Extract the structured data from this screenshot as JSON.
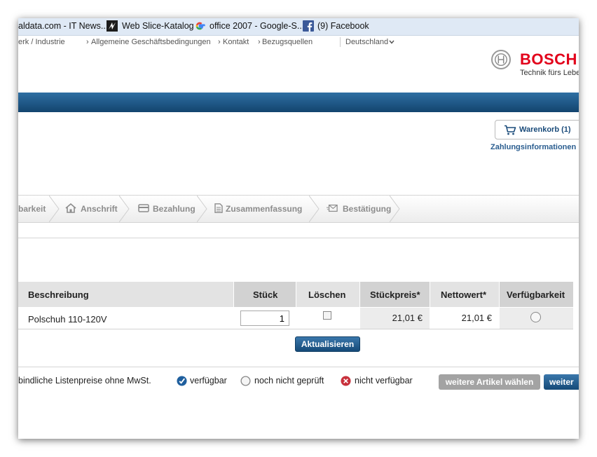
{
  "favorites": [
    {
      "label": "aldata.com - IT News..."
    },
    {
      "label": "Web Slice-Katalog"
    },
    {
      "label": "office 2007 - Google-S..."
    },
    {
      "label": "(9) Facebook"
    }
  ],
  "top_links": {
    "partial": "erk / Industrie",
    "terms": "Allgemeine Geschäftsbedingungen",
    "contact": "Kontakt",
    "sources": "Bezugsquellen",
    "country": "Deutschland"
  },
  "brand": {
    "name": "BOSCH",
    "slogan": "Technik fürs Leben",
    "color": "#e2001a"
  },
  "cart": {
    "label": "Warenkorb (1)",
    "payment_info": "Zahlungsinformationen"
  },
  "steps": [
    {
      "label": "barkeit",
      "icon": "partial-step"
    },
    {
      "label": "Anschrift",
      "icon": "house-icon"
    },
    {
      "label": "Bezahlung",
      "icon": "card-icon"
    },
    {
      "label": "Zusammenfassung",
      "icon": "document-icon"
    },
    {
      "label": "Bestätigung",
      "icon": "envelope-icon"
    }
  ],
  "table": {
    "headers": {
      "description": "Beschreibung",
      "qty": "Stück",
      "delete": "Löschen",
      "unit_price": "Stückpreis*",
      "net_value": "Nettowert*",
      "availability": "Verfügbarkeit"
    },
    "rows": [
      {
        "description": "Polschuh 110-120V",
        "qty": "1",
        "unit_price": "21,01 €",
        "net_value": "21,01 €"
      }
    ],
    "update_label": "Aktualisieren"
  },
  "footer": {
    "note": "bindliche Listenpreise ohne MwSt.",
    "legend_available": "verfügbar",
    "legend_unchecked": "noch nicht geprüft",
    "legend_unavailable": "nicht verfügbar",
    "more_articles": "weitere Artikel wählen",
    "next": "weiter"
  },
  "colors": {
    "accent_blue": "#1a4b7a",
    "available": "#1f5f9e",
    "unavailable": "#c8313c"
  }
}
